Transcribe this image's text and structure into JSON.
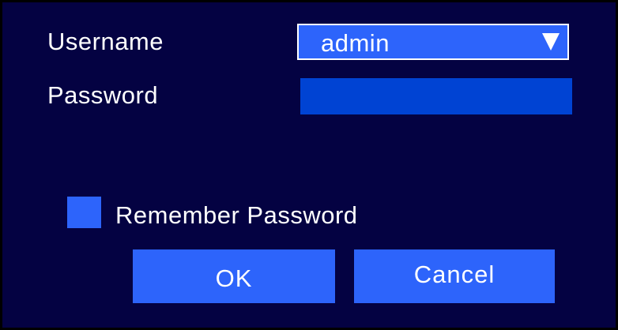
{
  "login": {
    "username_label": "Username",
    "username_value": "admin",
    "password_label": "Password",
    "password_value": "",
    "remember_label": "Remember Password",
    "remember_checked": false
  },
  "buttons": {
    "ok_label": "OK",
    "cancel_label": "Cancel"
  },
  "icons": {
    "dropdown": "triangle-down-icon"
  },
  "colors": {
    "background": "#040242",
    "accent": "#2d64fb",
    "field_active": "#0043d3",
    "text": "#ffffff"
  }
}
